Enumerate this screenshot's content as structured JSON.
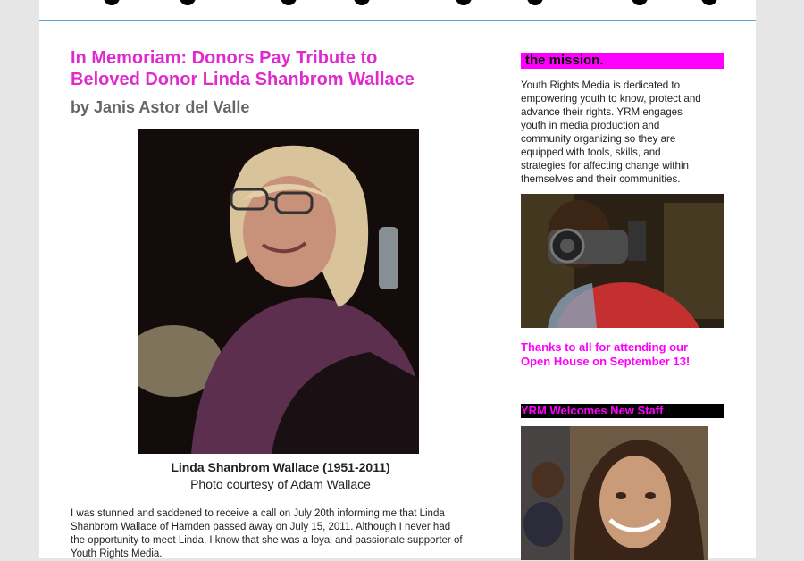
{
  "article": {
    "title_line1": "In Memoriam: Donors Pay Tribute to",
    "title_line2": "Beloved Donor Linda Shanbrom Wallace",
    "byline": "by Janis Astor del Valle",
    "photo_caption": "Linda Shanbrom Wallace (1951-2011)",
    "photo_credit": "Photo courtesy of Adam Wallace",
    "body_lines": [
      "I was stunned and saddened to receive a call on July 20th informing me that Linda",
      "Shanbrom Wallace of Hamden passed away on July 15, 2011.  Although I never had",
      "the opportunity to meet Linda, I know that she was a loyal and passionate supporter of",
      "Youth Rights Media."
    ]
  },
  "sidebar": {
    "mission_header": "the mission.",
    "mission_lines": [
      "Youth Rights Media is dedicated to",
      "empowering youth to know, protect and",
      "advance their rights.  YRM engages",
      "youth in media production and",
      "community organizing so they are",
      "equipped with tools, skills, and",
      "strategies for affecting change within",
      "themselves and their communities."
    ],
    "thanks_line1": "Thanks to all for attending our",
    "thanks_line2": "Open House on September 13!",
    "staff_header": "YRM Welcomes New Staff"
  },
  "colors": {
    "accent": "#e02ad0",
    "magenta": "#ff00ff",
    "rule": "#58a6d6"
  }
}
